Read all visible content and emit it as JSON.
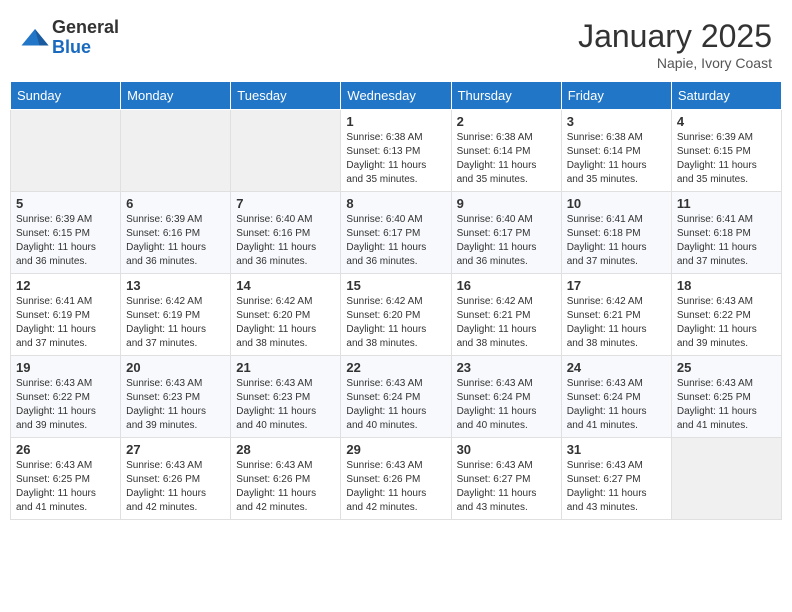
{
  "header": {
    "logo_general": "General",
    "logo_blue": "Blue",
    "month_title": "January 2025",
    "location": "Napie, Ivory Coast"
  },
  "days_of_week": [
    "Sunday",
    "Monday",
    "Tuesday",
    "Wednesday",
    "Thursday",
    "Friday",
    "Saturday"
  ],
  "weeks": [
    [
      {
        "day": "",
        "sunrise": "",
        "sunset": "",
        "daylight": ""
      },
      {
        "day": "",
        "sunrise": "",
        "sunset": "",
        "daylight": ""
      },
      {
        "day": "",
        "sunrise": "",
        "sunset": "",
        "daylight": ""
      },
      {
        "day": "1",
        "sunrise": "Sunrise: 6:38 AM",
        "sunset": "Sunset: 6:13 PM",
        "daylight": "Daylight: 11 hours and 35 minutes."
      },
      {
        "day": "2",
        "sunrise": "Sunrise: 6:38 AM",
        "sunset": "Sunset: 6:14 PM",
        "daylight": "Daylight: 11 hours and 35 minutes."
      },
      {
        "day": "3",
        "sunrise": "Sunrise: 6:38 AM",
        "sunset": "Sunset: 6:14 PM",
        "daylight": "Daylight: 11 hours and 35 minutes."
      },
      {
        "day": "4",
        "sunrise": "Sunrise: 6:39 AM",
        "sunset": "Sunset: 6:15 PM",
        "daylight": "Daylight: 11 hours and 35 minutes."
      }
    ],
    [
      {
        "day": "5",
        "sunrise": "Sunrise: 6:39 AM",
        "sunset": "Sunset: 6:15 PM",
        "daylight": "Daylight: 11 hours and 36 minutes."
      },
      {
        "day": "6",
        "sunrise": "Sunrise: 6:39 AM",
        "sunset": "Sunset: 6:16 PM",
        "daylight": "Daylight: 11 hours and 36 minutes."
      },
      {
        "day": "7",
        "sunrise": "Sunrise: 6:40 AM",
        "sunset": "Sunset: 6:16 PM",
        "daylight": "Daylight: 11 hours and 36 minutes."
      },
      {
        "day": "8",
        "sunrise": "Sunrise: 6:40 AM",
        "sunset": "Sunset: 6:17 PM",
        "daylight": "Daylight: 11 hours and 36 minutes."
      },
      {
        "day": "9",
        "sunrise": "Sunrise: 6:40 AM",
        "sunset": "Sunset: 6:17 PM",
        "daylight": "Daylight: 11 hours and 36 minutes."
      },
      {
        "day": "10",
        "sunrise": "Sunrise: 6:41 AM",
        "sunset": "Sunset: 6:18 PM",
        "daylight": "Daylight: 11 hours and 37 minutes."
      },
      {
        "day": "11",
        "sunrise": "Sunrise: 6:41 AM",
        "sunset": "Sunset: 6:18 PM",
        "daylight": "Daylight: 11 hours and 37 minutes."
      }
    ],
    [
      {
        "day": "12",
        "sunrise": "Sunrise: 6:41 AM",
        "sunset": "Sunset: 6:19 PM",
        "daylight": "Daylight: 11 hours and 37 minutes."
      },
      {
        "day": "13",
        "sunrise": "Sunrise: 6:42 AM",
        "sunset": "Sunset: 6:19 PM",
        "daylight": "Daylight: 11 hours and 37 minutes."
      },
      {
        "day": "14",
        "sunrise": "Sunrise: 6:42 AM",
        "sunset": "Sunset: 6:20 PM",
        "daylight": "Daylight: 11 hours and 38 minutes."
      },
      {
        "day": "15",
        "sunrise": "Sunrise: 6:42 AM",
        "sunset": "Sunset: 6:20 PM",
        "daylight": "Daylight: 11 hours and 38 minutes."
      },
      {
        "day": "16",
        "sunrise": "Sunrise: 6:42 AM",
        "sunset": "Sunset: 6:21 PM",
        "daylight": "Daylight: 11 hours and 38 minutes."
      },
      {
        "day": "17",
        "sunrise": "Sunrise: 6:42 AM",
        "sunset": "Sunset: 6:21 PM",
        "daylight": "Daylight: 11 hours and 38 minutes."
      },
      {
        "day": "18",
        "sunrise": "Sunrise: 6:43 AM",
        "sunset": "Sunset: 6:22 PM",
        "daylight": "Daylight: 11 hours and 39 minutes."
      }
    ],
    [
      {
        "day": "19",
        "sunrise": "Sunrise: 6:43 AM",
        "sunset": "Sunset: 6:22 PM",
        "daylight": "Daylight: 11 hours and 39 minutes."
      },
      {
        "day": "20",
        "sunrise": "Sunrise: 6:43 AM",
        "sunset": "Sunset: 6:23 PM",
        "daylight": "Daylight: 11 hours and 39 minutes."
      },
      {
        "day": "21",
        "sunrise": "Sunrise: 6:43 AM",
        "sunset": "Sunset: 6:23 PM",
        "daylight": "Daylight: 11 hours and 40 minutes."
      },
      {
        "day": "22",
        "sunrise": "Sunrise: 6:43 AM",
        "sunset": "Sunset: 6:24 PM",
        "daylight": "Daylight: 11 hours and 40 minutes."
      },
      {
        "day": "23",
        "sunrise": "Sunrise: 6:43 AM",
        "sunset": "Sunset: 6:24 PM",
        "daylight": "Daylight: 11 hours and 40 minutes."
      },
      {
        "day": "24",
        "sunrise": "Sunrise: 6:43 AM",
        "sunset": "Sunset: 6:24 PM",
        "daylight": "Daylight: 11 hours and 41 minutes."
      },
      {
        "day": "25",
        "sunrise": "Sunrise: 6:43 AM",
        "sunset": "Sunset: 6:25 PM",
        "daylight": "Daylight: 11 hours and 41 minutes."
      }
    ],
    [
      {
        "day": "26",
        "sunrise": "Sunrise: 6:43 AM",
        "sunset": "Sunset: 6:25 PM",
        "daylight": "Daylight: 11 hours and 41 minutes."
      },
      {
        "day": "27",
        "sunrise": "Sunrise: 6:43 AM",
        "sunset": "Sunset: 6:26 PM",
        "daylight": "Daylight: 11 hours and 42 minutes."
      },
      {
        "day": "28",
        "sunrise": "Sunrise: 6:43 AM",
        "sunset": "Sunset: 6:26 PM",
        "daylight": "Daylight: 11 hours and 42 minutes."
      },
      {
        "day": "29",
        "sunrise": "Sunrise: 6:43 AM",
        "sunset": "Sunset: 6:26 PM",
        "daylight": "Daylight: 11 hours and 42 minutes."
      },
      {
        "day": "30",
        "sunrise": "Sunrise: 6:43 AM",
        "sunset": "Sunset: 6:27 PM",
        "daylight": "Daylight: 11 hours and 43 minutes."
      },
      {
        "day": "31",
        "sunrise": "Sunrise: 6:43 AM",
        "sunset": "Sunset: 6:27 PM",
        "daylight": "Daylight: 11 hours and 43 minutes."
      },
      {
        "day": "",
        "sunrise": "",
        "sunset": "",
        "daylight": ""
      }
    ]
  ]
}
